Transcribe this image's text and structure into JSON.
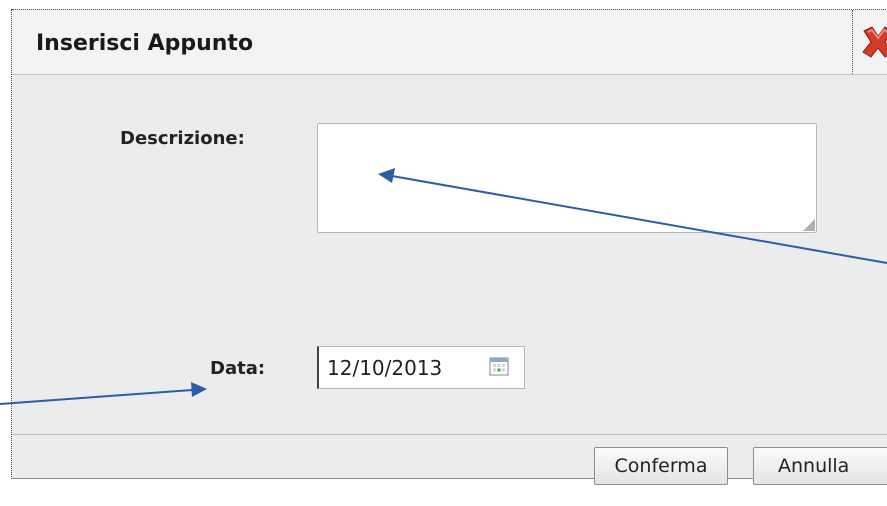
{
  "dialog": {
    "title": "Inserisci Appunto",
    "close_icon": "close-x-icon"
  },
  "form": {
    "description_label": "Descrizione:",
    "description_value": "",
    "date_label": "Data:",
    "date_value": "12/10/2013",
    "date_icon": "calendar-icon"
  },
  "footer": {
    "confirm_label": "Conferma",
    "cancel_label": "Annulla"
  },
  "colors": {
    "dialog_background": "#ececec",
    "title_background": "#f3f3f3",
    "close_icon": "#d23a2a",
    "annotation_arrow": "#2b5da8"
  }
}
